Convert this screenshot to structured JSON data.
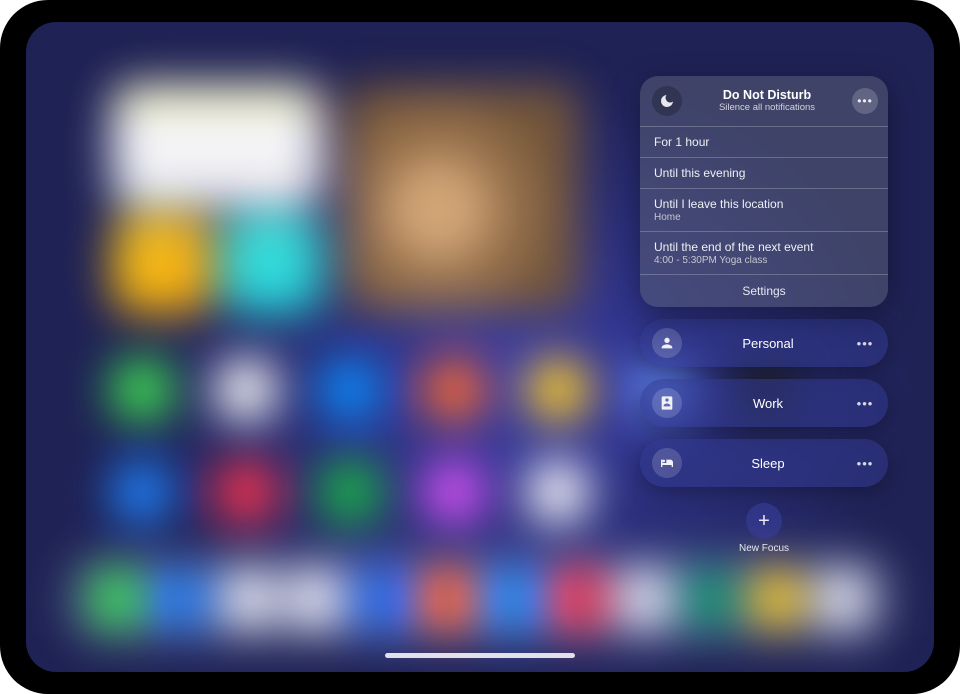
{
  "dnd": {
    "title": "Do Not Disturb",
    "subtitle": "Silence all notifications",
    "options": [
      {
        "label": "For 1 hour",
        "sub": ""
      },
      {
        "label": "Until this evening",
        "sub": ""
      },
      {
        "label": "Until I leave this location",
        "sub": "Home"
      },
      {
        "label": "Until the end of the next event",
        "sub": "4:00 - 5:30PM Yoga class"
      }
    ],
    "settings_label": "Settings"
  },
  "focus_modes": [
    {
      "name": "Personal",
      "icon": "person"
    },
    {
      "name": "Work",
      "icon": "badge"
    },
    {
      "name": "Sleep",
      "icon": "bed"
    }
  ],
  "new_focus_label": "New Focus",
  "bg_apps": {
    "row1": [
      "#53d162",
      "#f6f6fa",
      "#1e83ff",
      "#ff6a3d",
      "#f1c443",
      "#6b8be8",
      "#1d1f22"
    ],
    "row2": [
      "#2f7cff",
      "#ff3b4e",
      "#2ea84f",
      "#c057d6",
      "#f0f0f4"
    ],
    "dock": [
      "#4cd463",
      "#2f7cff",
      "#eeeef4",
      "#f1f1f6",
      "#2e6cff",
      "#ff6a3d",
      "#2d8cff",
      "#ff3e4e",
      "#e8e8ef",
      "#1f8f6b",
      "#f0ca3f",
      "#e8e8ef"
    ]
  }
}
